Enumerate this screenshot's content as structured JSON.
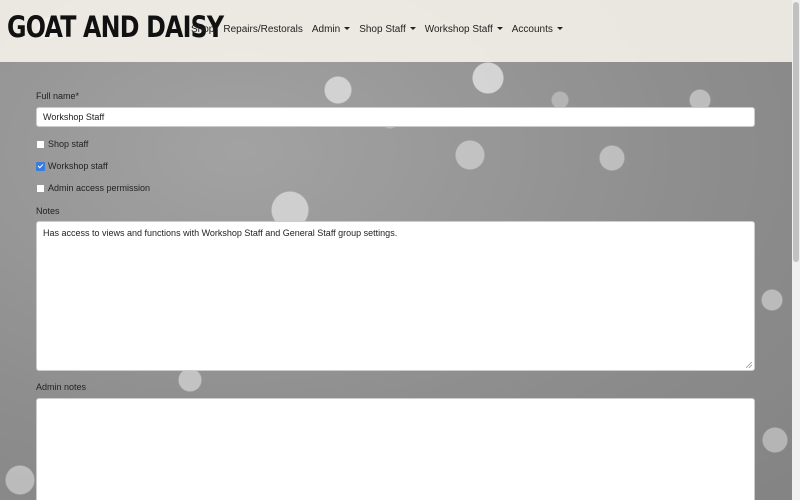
{
  "brand": "GOAT AND DAISY",
  "nav": {
    "items": [
      {
        "label": "Shop",
        "dropdown": false
      },
      {
        "label": "Repairs/Restorals",
        "dropdown": false
      },
      {
        "label": "Admin",
        "dropdown": true
      },
      {
        "label": "Shop Staff",
        "dropdown": true
      },
      {
        "label": "Workshop Staff",
        "dropdown": true
      },
      {
        "label": "Accounts",
        "dropdown": true
      }
    ]
  },
  "form": {
    "full_name_label": "Full name",
    "full_name_required": "*",
    "full_name_value": "Workshop Staff",
    "checkboxes": {
      "shop_staff": {
        "label": "Shop staff",
        "checked": false
      },
      "workshop_staff": {
        "label": "Workshop staff",
        "checked": true
      },
      "admin_access": {
        "label": "Admin access permission",
        "checked": false
      }
    },
    "notes_label": "Notes",
    "notes_value": "Has access to views and functions with Workshop Staff and General Staff group settings.",
    "admin_notes_label": "Admin notes",
    "admin_notes_value": ""
  },
  "colors": {
    "checkbox_accent": "#3a7be0",
    "header_bg": "#f6f4ec"
  }
}
